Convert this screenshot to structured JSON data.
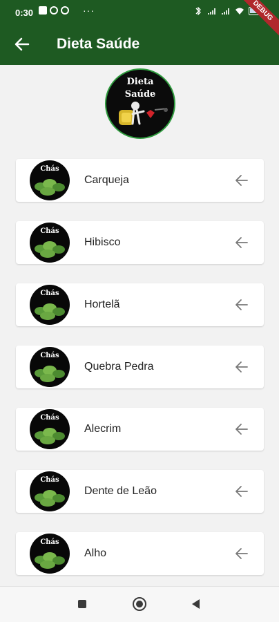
{
  "status_bar": {
    "time": "0:30",
    "debug_banner": "DEBUG"
  },
  "appbar": {
    "title": "Dieta Saúde",
    "bg_color": "#1e5a22"
  },
  "logo": {
    "line1": "Dieta",
    "line2": "Saúde"
  },
  "items": [
    {
      "name": "Carqueja",
      "avatar_label": "Chás"
    },
    {
      "name": "Hibisco",
      "avatar_label": "Chás"
    },
    {
      "name": "Hortelã",
      "avatar_label": "Chás"
    },
    {
      "name": "Quebra Pedra",
      "avatar_label": "Chás"
    },
    {
      "name": "Alecrim",
      "avatar_label": "Chás"
    },
    {
      "name": "Dente de Leão",
      "avatar_label": "Chás"
    },
    {
      "name": "Alho",
      "avatar_label": "Chás"
    }
  ],
  "icons": {
    "back": "arrow-left-icon",
    "item_action": "arrow-left-icon",
    "nav_recents": "square-icon",
    "nav_home": "circle-icon",
    "nav_back": "triangle-back-icon"
  }
}
